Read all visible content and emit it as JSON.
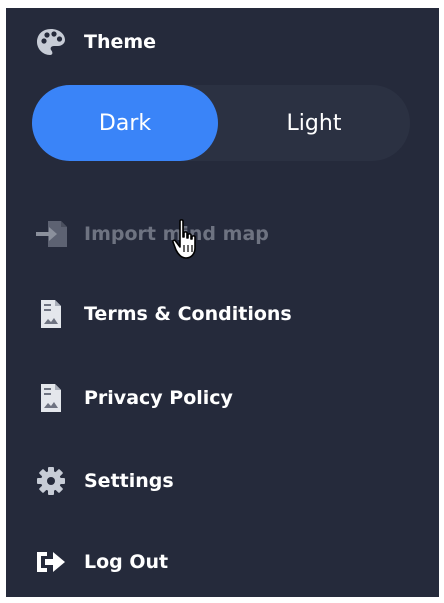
{
  "theme": {
    "label": "Theme",
    "icon": "palette-icon",
    "options": [
      {
        "label": "Dark",
        "selected": true
      },
      {
        "label": "Light",
        "selected": false
      }
    ],
    "accent_color": "#3a84f8"
  },
  "menu": {
    "import": {
      "label": "Import mind map",
      "icon": "import-arrow-icon",
      "disabled": true
    },
    "terms": {
      "label": "Terms & Conditions",
      "icon": "document-icon"
    },
    "privacy": {
      "label": "Privacy Policy",
      "icon": "document-icon"
    },
    "settings": {
      "label": "Settings",
      "icon": "gear-icon"
    },
    "logout": {
      "label": "Log Out",
      "icon": "logout-arrow-icon"
    }
  },
  "colors": {
    "panel_bg": "#252a3b",
    "toggle_bg": "#2b3142",
    "disabled_text": "#6e7381"
  }
}
